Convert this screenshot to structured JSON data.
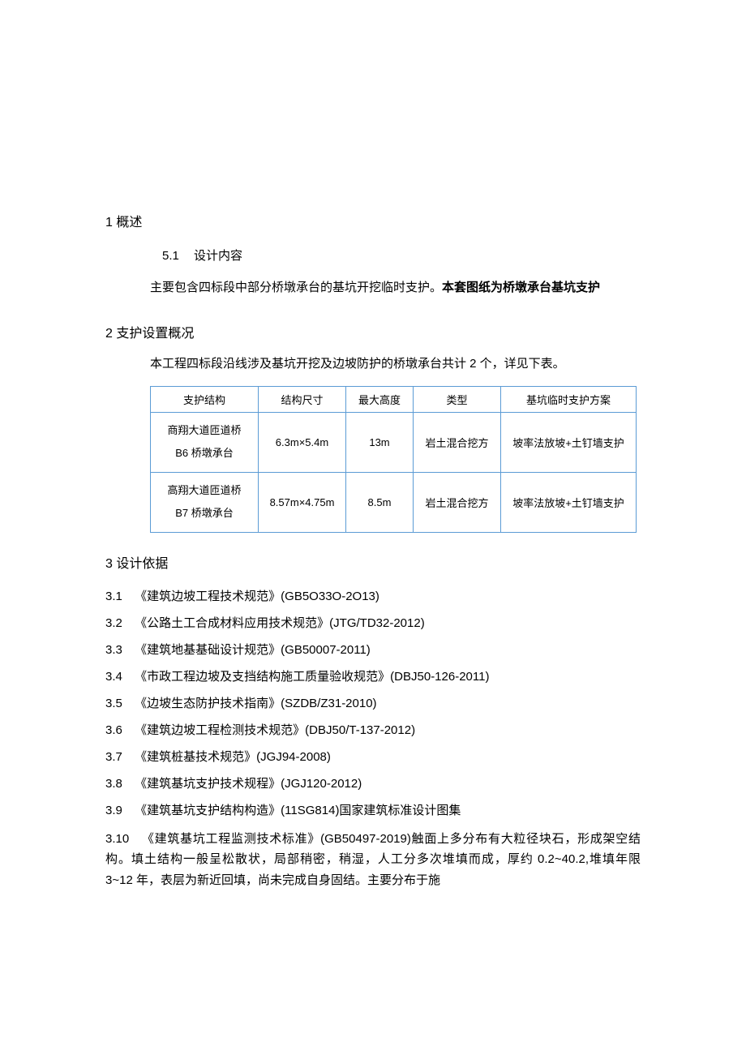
{
  "s1": {
    "heading": "1 概述",
    "sub_num": "5.1",
    "sub_label": "设计内容",
    "para_a": "主要包含四标段中部分桥墩承台的基坑开挖临时支护。",
    "para_b_bold": "本套图纸为桥墩承台基坑支护"
  },
  "s2": {
    "heading": "2 支护设置概况",
    "intro": "本工程四标段沿线涉及基坑开挖及边坡防护的桥墩承台共计 2 个，详见下表。",
    "table": {
      "headers": {
        "c1": "支护结构",
        "c2": "结构尺寸",
        "c3": "最大高度",
        "c4": "类型",
        "c5": "基坑临时支护方案"
      },
      "rows": [
        {
          "c1a": "商翔大道匝道桥",
          "c1b": "B6 桥墩承台",
          "c2": "6.3m×5.4m",
          "c3": "13m",
          "c4": "岩土混合挖方",
          "c5": "坡率法放坡+土钉墙支护"
        },
        {
          "c1a": "高翔大道匝道桥",
          "c1b": "B7 桥墩承台",
          "c2": "8.57m×4.75m",
          "c3": "8.5m",
          "c4": "岩土混合挖方",
          "c5": "坡率法放坡+土钉墙支护"
        }
      ]
    }
  },
  "s3": {
    "heading": "3 设计依据",
    "items": [
      {
        "n": "3.1",
        "t": "《建筑边坡工程技术规范》(GB5O33O-2O13)"
      },
      {
        "n": "3.2",
        "t": "《公路土工合成材料应用技术规范》(JTG/TD32-2012)"
      },
      {
        "n": "3.3",
        "t": "《建筑地基基础设计规范》(GB50007-2011)"
      },
      {
        "n": "3.4",
        "t": "《市政工程边坡及支挡结构施工质量验收规范》(DBJ50-126-2011)"
      },
      {
        "n": "3.5",
        "t": "《边坡生态防护技术指南》(SZDB/Z31-2010)"
      },
      {
        "n": "3.6",
        "t": "《建筑边坡工程检测技术规范》(DBJ50/T-137-2012)"
      },
      {
        "n": "3.7",
        "t": "《建筑桩基技术规范》(JGJ94-2008)"
      },
      {
        "n": "3.8",
        "t": "《建筑基坑支护技术规程》(JGJ120-2012)"
      },
      {
        "n": "3.9",
        "t": "《建筑基坑支护结构构造》(11SG814)国家建筑标准设计图集"
      }
    ],
    "item10": {
      "n": "3.10",
      "t": "《建筑基坑工程监测技术标准》(GB50497-2019)触面上多分布有大粒径块石，形成架空结构。填土结构一般呈松散状，局部稍密，稍湿，人工分多次堆填而成，厚约 0.2~40.2,堆填年限 3~12 年，表层为新近回填，尚未完成自身固结。主要分布于施"
    }
  }
}
